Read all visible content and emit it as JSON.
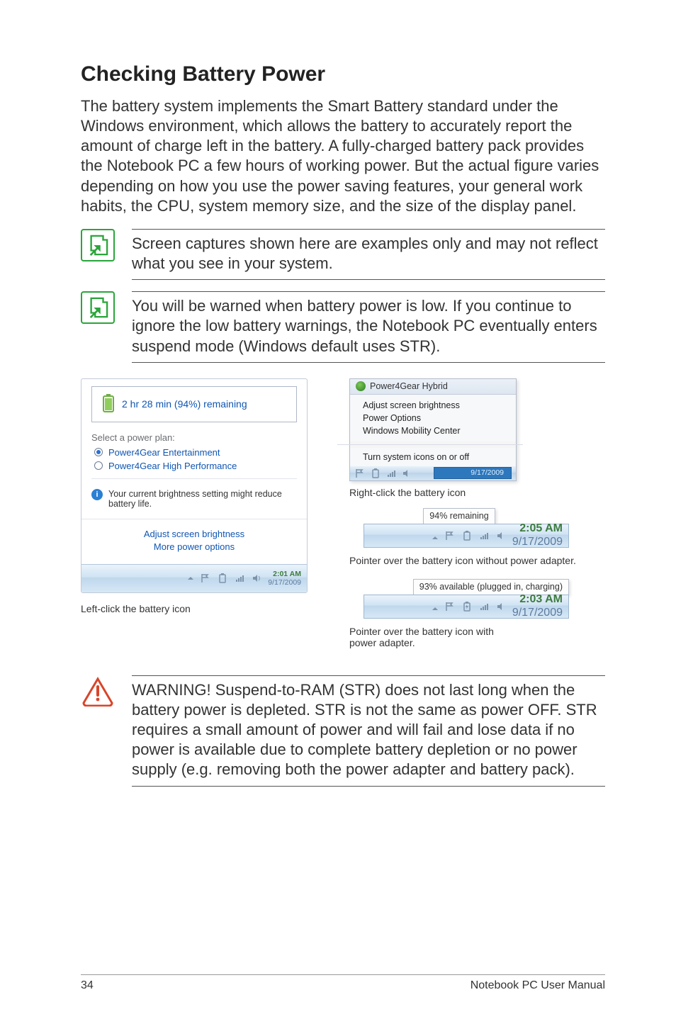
{
  "page": {
    "number": "34",
    "footer": "Notebook PC User Manual"
  },
  "heading": "Checking Battery Power",
  "intro": "The battery system implements the Smart Battery standard under the Windows environment, which allows the battery to accurately report the amount of charge left in the battery. A fully-charged battery pack provides the Notebook PC a few hours of working power. But the actual figure varies depending on how you use the power saving features, your general work habits, the CPU, system memory size, and the size of the display panel.",
  "notes": {
    "note1": "Screen captures shown here are examples only and may not reflect what you see in your system.",
    "note2": "You will be warned when battery power is low. If you continue to ignore the low battery warnings, the Notebook PC eventually enters suspend mode (Windows default uses STR).",
    "warning": "WARNING!  Suspend-to-RAM (STR) does not last long when the battery power is depleted. STR is not the same as power OFF. STR requires a small amount of power and will fail and lose data if no power is available due to complete battery depletion or no power supply (e.g. removing both the power adapter and battery pack)."
  },
  "leftPanel": {
    "remaining": "2 hr 28 min (94%) remaining",
    "selectLabel": "Select a power plan:",
    "opt1": "Power4Gear Entertainment",
    "opt2": "Power4Gear High Performance",
    "info": "Your current brightness setting might reduce battery life.",
    "link1": "Adjust screen brightness",
    "link2": "More power options",
    "time": "2:01 AM",
    "date": "9/17/2009",
    "caption": "Left-click the battery icon"
  },
  "rightCol": {
    "contextTitle": "Power4Gear Hybrid",
    "c1": "Adjust screen brightness",
    "c2": "Power Options",
    "c3": "Windows Mobility Center",
    "c4": "Turn system icons on or off",
    "ctxDate": "9/17/2009",
    "ctxCaption": "Right-click the battery icon",
    "tip1": "94% remaining",
    "tip1Time": "2:05 AM",
    "tip1Date": "9/17/2009",
    "tip1Caption": "Pointer over the battery icon without power adapter.",
    "tip2": "93% available (plugged in, charging)",
    "tip2Time": "2:03 AM",
    "tip2Date": "9/17/2009",
    "tip2Caption1": "Pointer over the battery icon with",
    "tip2Caption2": "power adapter."
  }
}
